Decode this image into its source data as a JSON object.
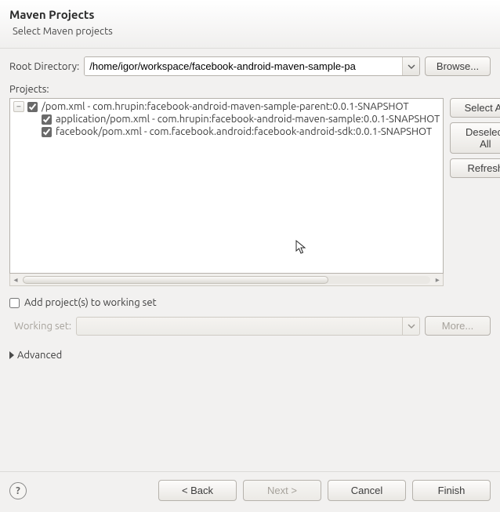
{
  "header": {
    "title": "Maven Projects",
    "subtitle": "Select Maven projects"
  },
  "rootDirectory": {
    "label": "Root Directory:",
    "value": "/home/igor/workspace/facebook-android-maven-sample-pa",
    "browse": "Browse..."
  },
  "projects": {
    "label": "Projects:",
    "tree": [
      {
        "indent": 0,
        "toggle": "−",
        "checked": true,
        "text": "/pom.xml - com.hrupin:facebook-android-maven-sample-parent:0.0.1-SNAPSHOT"
      },
      {
        "indent": 1,
        "toggle": "",
        "checked": true,
        "text": "application/pom.xml - com.hrupin:facebook-android-maven-sample:0.0.1-SNAPSHOT"
      },
      {
        "indent": 1,
        "toggle": "",
        "checked": true,
        "text": "facebook/pom.xml - com.facebook.android:facebook-android-sdk:0.0.1-SNAPSHOT"
      }
    ]
  },
  "sideButtons": {
    "selectAll": "Select All",
    "deselectAll": "Deselect All",
    "refresh": "Refresh"
  },
  "workingSet": {
    "addLabel": "Add project(s) to working set",
    "checked": false,
    "fieldLabel": "Working set:",
    "more": "More..."
  },
  "advanced": {
    "label": "Advanced"
  },
  "footer": {
    "back": "< Back",
    "next": "Next >",
    "cancel": "Cancel",
    "finish": "Finish"
  }
}
